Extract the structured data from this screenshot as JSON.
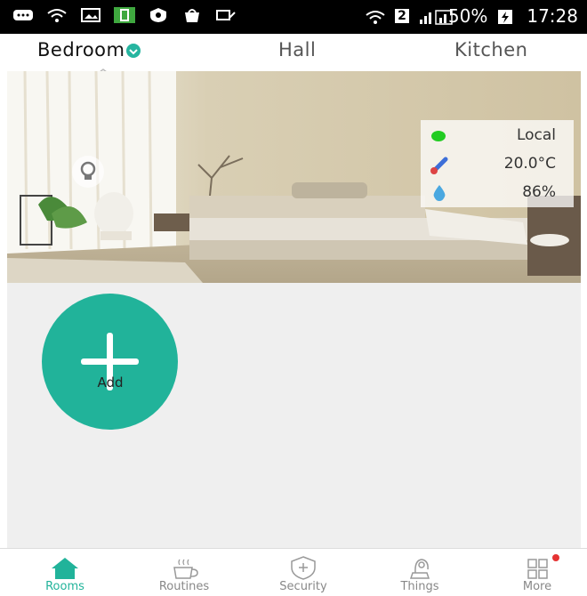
{
  "status_bar": {
    "battery": "50%",
    "time": "17:28",
    "sim_slot": "2"
  },
  "tabs": [
    {
      "label": "Bedroom",
      "active": true
    },
    {
      "label": "Hall",
      "active": false
    },
    {
      "label": "Kitchen",
      "active": false
    }
  ],
  "room_panel": {
    "mode": "Local",
    "temperature": "20.0°C",
    "humidity": "86%"
  },
  "add": {
    "label": "Add"
  },
  "bottom_nav": [
    {
      "label": "Rooms",
      "icon": "home-icon",
      "active": true
    },
    {
      "label": "Routines",
      "icon": "cup-icon",
      "active": false
    },
    {
      "label": "Security",
      "icon": "shield-icon",
      "active": false
    },
    {
      "label": "Things",
      "icon": "device-icon",
      "active": false
    },
    {
      "label": "More",
      "icon": "grid-icon",
      "active": false,
      "badge": true
    }
  ],
  "colors": {
    "accent": "#21b39a",
    "status_ok": "#22cc22",
    "thermo": "#3d6fd8"
  }
}
